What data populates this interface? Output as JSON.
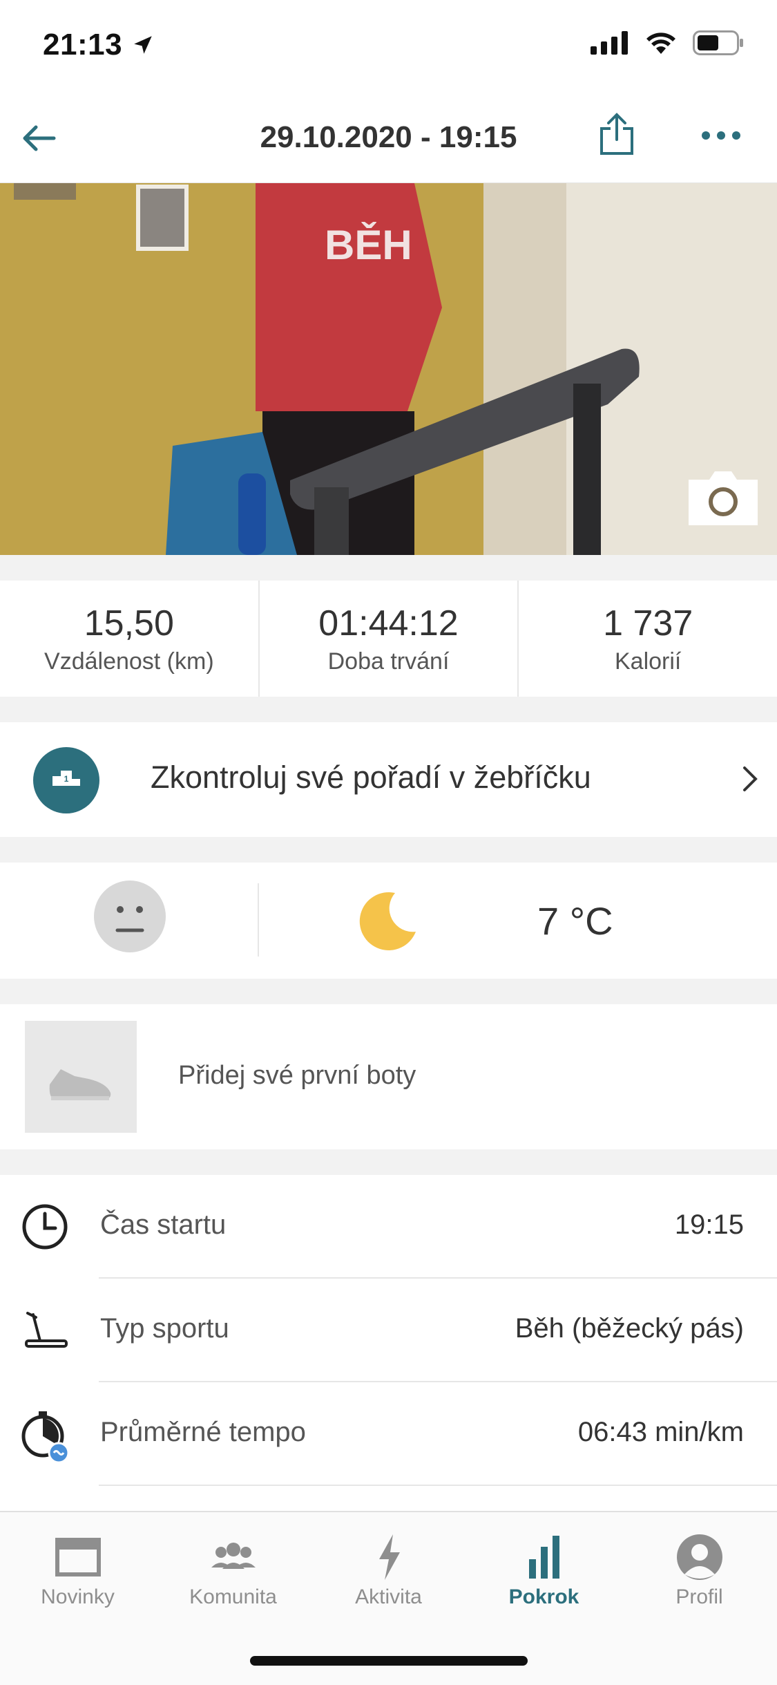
{
  "status_bar": {
    "time": "21:13"
  },
  "header": {
    "title": "29.10.2020 - 19:15"
  },
  "stats": [
    {
      "value": "15,50",
      "label": "Vzdálenost (km)"
    },
    {
      "value": "01:44:12",
      "label": "Doba trvání"
    },
    {
      "value": "1 737",
      "label": "Kalorií"
    }
  ],
  "leaderboard": {
    "label": "Zkontroluj své pořadí v žebříčku"
  },
  "weather": {
    "temperature": "7 °C"
  },
  "shoes": {
    "label": "Přidej své první boty"
  },
  "details": [
    {
      "icon": "clock-icon",
      "label": "Čas startu",
      "value": "19:15"
    },
    {
      "icon": "treadmill-icon",
      "label": "Typ sportu",
      "value": "Běh (běžecký pás)"
    },
    {
      "icon": "pace-stopwatch-icon",
      "label": "Průměrné tempo",
      "value": "06:43 min/km"
    }
  ],
  "tabs": [
    {
      "label": "Novinky",
      "icon": "news-icon",
      "active": false
    },
    {
      "label": "Komunita",
      "icon": "community-icon",
      "active": false
    },
    {
      "label": "Aktivita",
      "icon": "lightning-icon",
      "active": false
    },
    {
      "label": "Pokrok",
      "icon": "bar-chart-icon",
      "active": true
    },
    {
      "label": "Profil",
      "icon": "profile-icon",
      "active": false
    }
  ],
  "colors": {
    "accent": "#2c6f7d",
    "moon": "#f5c34a",
    "separator": "#f2f2f2"
  }
}
